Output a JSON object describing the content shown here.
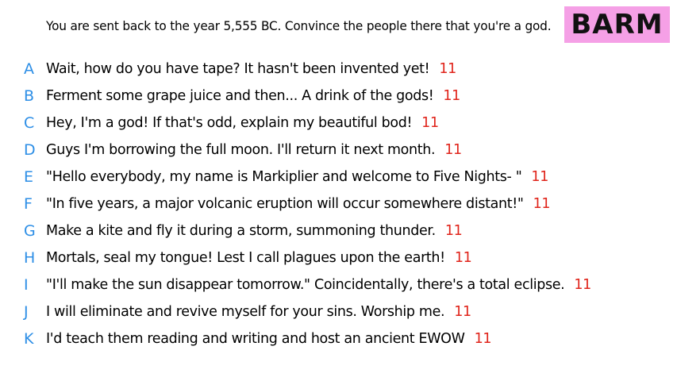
{
  "prompt": "You are sent back to the year 5,555 BC. Convince the people there that you're a god.",
  "badge": {
    "label": "BARM",
    "color": "#f5a0e6"
  },
  "colors": {
    "letter": "#2c8ee6",
    "count": "#e0241b"
  },
  "responses": [
    {
      "letter": "A",
      "text": "Wait, how do you have tape? It hasn't been invented yet!",
      "count": "11"
    },
    {
      "letter": "B",
      "text": "Ferment some grape juice and then... A drink of the gods!",
      "count": "11"
    },
    {
      "letter": "C",
      "text": "Hey, I'm a god! If that's odd, explain my beautiful bod!",
      "count": "11"
    },
    {
      "letter": "D",
      "text": "Guys I'm borrowing the full moon. I'll return it next month.",
      "count": "11"
    },
    {
      "letter": "E",
      "text": "\"Hello everybody, my name is Markiplier and welcome to Five Nights- \"",
      "count": "11"
    },
    {
      "letter": "F",
      "text": "\"In five years, a major volcanic eruption will occur somewhere distant!\"",
      "count": "11"
    },
    {
      "letter": "G",
      "text": "Make a kite and fly it during a storm, summoning thunder.",
      "count": "11"
    },
    {
      "letter": "H",
      "text": "Mortals, seal my tongue! Lest I call plagues upon the earth!",
      "count": "11"
    },
    {
      "letter": "I",
      "text": "\"I'll make the sun disappear tomorrow.\" Coincidentally, there's a total eclipse.",
      "count": "11"
    },
    {
      "letter": "J",
      "text": "I will eliminate and revive myself for your sins. Worship me.",
      "count": "11"
    },
    {
      "letter": "K",
      "text": "I'd teach them reading and writing and host an ancient EWOW",
      "count": "11"
    }
  ]
}
